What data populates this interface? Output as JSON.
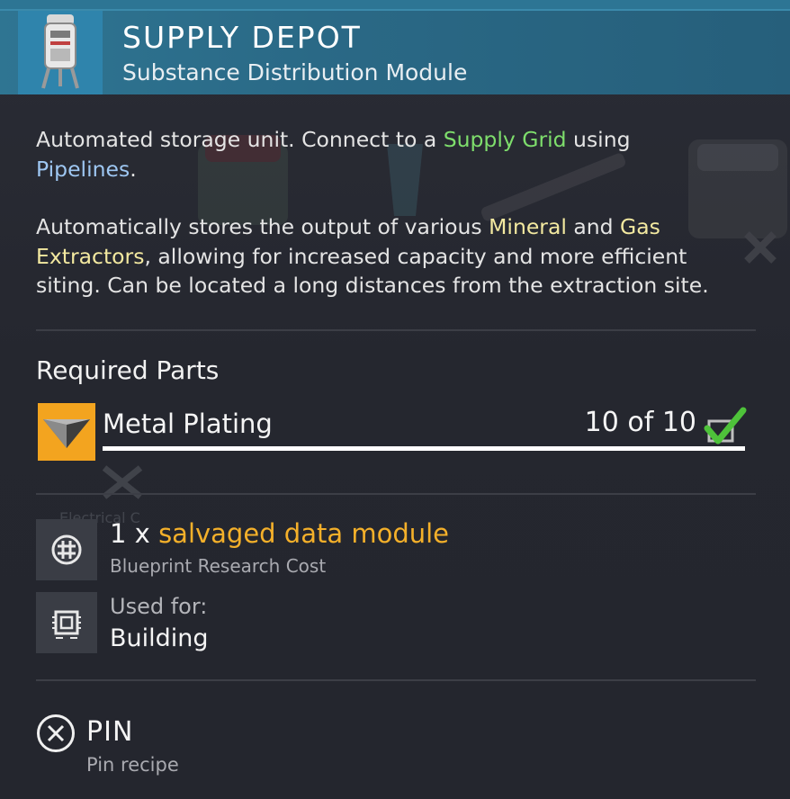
{
  "header": {
    "title": "SUPPLY DEPOT",
    "subtitle": "Substance Distribution Module",
    "icon": "supply-depot-icon"
  },
  "description": {
    "p1": {
      "t1": "Automated storage unit. Connect to a ",
      "supply_grid": "Supply Grid",
      "t2": " using",
      "pipelines": "Pipelines",
      "t3": "."
    },
    "p2": {
      "t1": "Automatically stores the output of various ",
      "mineral": "Mineral",
      "t2": " and ",
      "gas": "Gas",
      "extractors": "Extractors",
      "t3": ", allowing for increased capacity and more efficient",
      "t4": "siting. Can be located a long distances from the extraction site."
    }
  },
  "required": {
    "heading": "Required Parts",
    "part": {
      "name": "Metal Plating",
      "count": "10 of 10",
      "progress": 1.0,
      "icon": "metal-plating-icon",
      "check_icon": "check-icon"
    }
  },
  "research": {
    "qty": "1 x ",
    "item": "salvaged data module",
    "label": "Blueprint Research Cost",
    "icon": "data-module-icon"
  },
  "used_for": {
    "label": "Used for:",
    "value": "Building",
    "icon": "building-chip-icon"
  },
  "pin": {
    "label": "PIN",
    "sub": "Pin recipe",
    "icon": "x-button-icon"
  },
  "colors": {
    "header_bg": "#2a6986",
    "accent_green": "#7ede6c",
    "accent_blue": "#9ec7f2",
    "accent_yellow": "#f3e9a0",
    "accent_orange": "#f4b02a",
    "part_icon_bg": "#f3a41f"
  }
}
